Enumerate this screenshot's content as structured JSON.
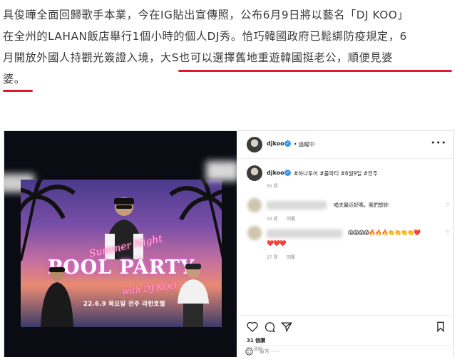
{
  "article": {
    "line1": "具俊曄全面回歸歌手本業，今在IG貼出宣傳照，公布6月9日將以藝名「DJ KOO」",
    "line2": "在全州的LAHAN飯店舉行1個小時的個人DJ秀。恰巧韓國政府已鬆綁防疫規定，6",
    "line3_plain": "月開放外國人持觀光簽證入境，",
    "line3_hl": "大S也可以選擇舊地重遊韓國挺老公，順便見婆",
    "line4_hl": "婆。"
  },
  "instagram": {
    "header": {
      "username": "djkoo",
      "follow": "• 追蹤中",
      "more": "•••"
    },
    "caption": {
      "username": "djkoo",
      "text": "#하나투어 #풀파티 #6월9일 #전주",
      "time": "55 週"
    },
    "comments": [
      {
        "text": "唱夫最近好嗎，我們想你",
        "time": "19 週",
        "reply": "回覆"
      },
      {
        "emoji_line1": "😱😱😱😱🔥🔥🔥👏👏👏👏❤️",
        "emoji_line2": "❤️❤️❤️",
        "time": "27 週",
        "reply": "回覆"
      }
    ],
    "likes": "31 個讚",
    "post_time": "55 週前",
    "add_comment": "留言⋯⋯",
    "poster": {
      "summer": "Summer Night",
      "title": "POOL PARTY",
      "with": "with DJ KOO",
      "date": "22.6.9 목요일  전주 라한호텔"
    }
  },
  "colors": {
    "highlight_underline": "#e0192d",
    "verified": "#3897f0"
  }
}
